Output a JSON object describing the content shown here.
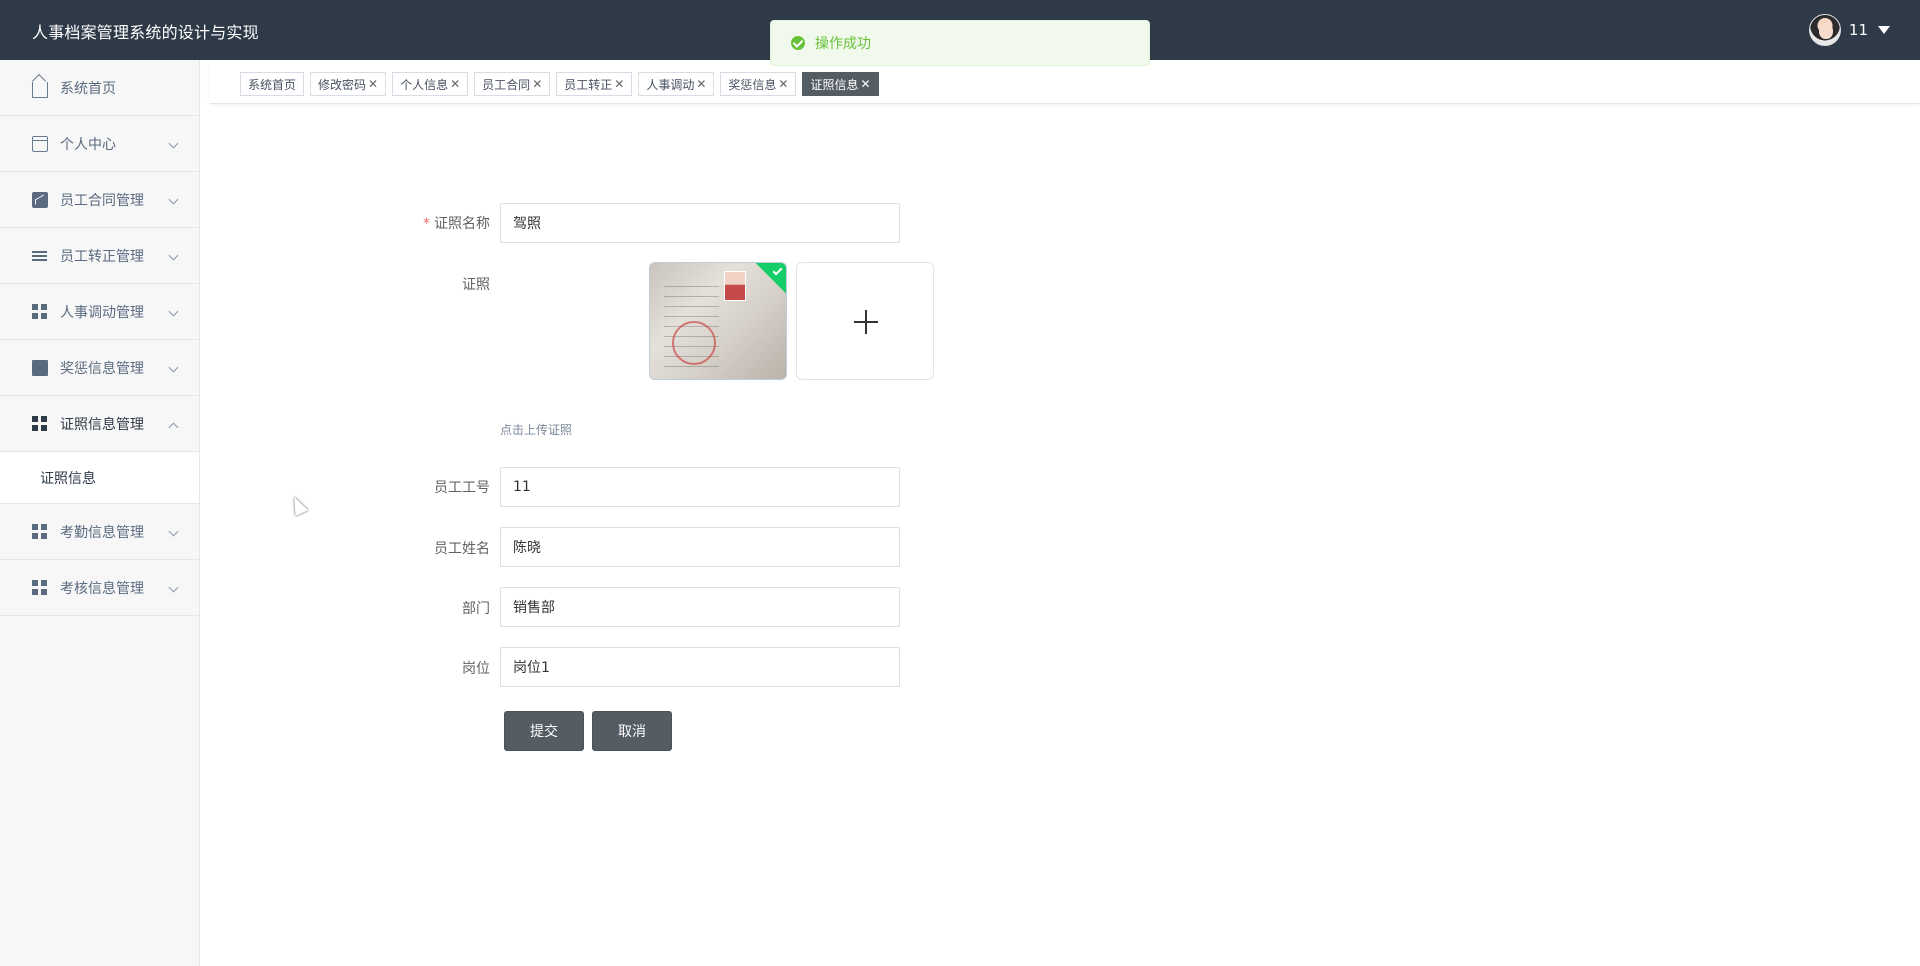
{
  "header": {
    "title": "人事档案管理系统的设计与实现",
    "username": "11"
  },
  "toast": {
    "message": "操作成功"
  },
  "sidebar": {
    "items": [
      {
        "label": "系统首页",
        "icon": "home-icon"
      },
      {
        "label": "个人中心",
        "icon": "card-icon"
      },
      {
        "label": "员工合同管理",
        "icon": "chart-icon"
      },
      {
        "label": "员工转正管理",
        "icon": "list-icon"
      },
      {
        "label": "人事调动管理",
        "icon": "grid-icon"
      },
      {
        "label": "奖惩信息管理",
        "icon": "monitor-icon"
      },
      {
        "label": "证照信息管理",
        "icon": "grid-icon",
        "expanded": true
      },
      {
        "label": "考勤信息管理",
        "icon": "grid-icon"
      },
      {
        "label": "考核信息管理",
        "icon": "grid-icon"
      }
    ],
    "submenu": {
      "label": "证照信息"
    }
  },
  "tabs": [
    {
      "label": "系统首页",
      "closable": false
    },
    {
      "label": "修改密码",
      "closable": true
    },
    {
      "label": "个人信息",
      "closable": true
    },
    {
      "label": "员工合同",
      "closable": true
    },
    {
      "label": "员工转正",
      "closable": true
    },
    {
      "label": "人事调动",
      "closable": true
    },
    {
      "label": "奖惩信息",
      "closable": true
    },
    {
      "label": "证照信息",
      "closable": true,
      "active": true
    }
  ],
  "form": {
    "cert_name": {
      "label": "证照名称",
      "value": "驾照"
    },
    "cert_image": {
      "label": "证照",
      "tip": "点击上传证照"
    },
    "employee_id": {
      "label": "员工工号",
      "value": "11"
    },
    "employee_name": {
      "label": "员工姓名",
      "value": "陈晓"
    },
    "department": {
      "label": "部门",
      "value": "销售部"
    },
    "position": {
      "label": "岗位",
      "value": "岗位1"
    },
    "submit_label": "提交",
    "cancel_label": "取消"
  },
  "colors": {
    "header_bg": "#2f3a48",
    "toast_success": "#67c23a",
    "button_bg": "#545c64",
    "active_tab_bg": "#545c64"
  }
}
